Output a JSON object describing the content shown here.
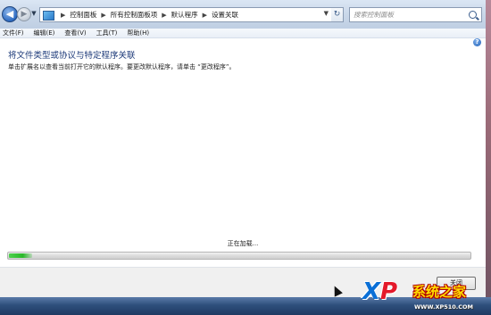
{
  "navigation": {
    "back_icon": "back-arrow-icon",
    "forward_icon": "forward-arrow-icon",
    "breadcrumbs": [
      "控制面板",
      "所有控制面板项",
      "默认程序",
      "设置关联"
    ],
    "search_placeholder": "搜索控制面板"
  },
  "menu": {
    "items": [
      "文件(F)",
      "编辑(E)",
      "查看(V)",
      "工具(T)",
      "帮助(H)"
    ]
  },
  "content": {
    "title": "将文件类型或协议与特定程序关联",
    "description": "单击扩展名以查看当前打开它的默认程序。要更改默认程序，请单击 “更改程序”。",
    "loading_text": "正在加载...",
    "progress_fraction": 0.05
  },
  "footer": {
    "close_label": "关闭"
  },
  "watermark": {
    "logo_x": "X",
    "logo_p": "P",
    "brand": "系统之家",
    "url": "WWW.XP510.COM"
  },
  "colors": {
    "title": "#1e3b7a",
    "progress_green": "#29b829"
  }
}
